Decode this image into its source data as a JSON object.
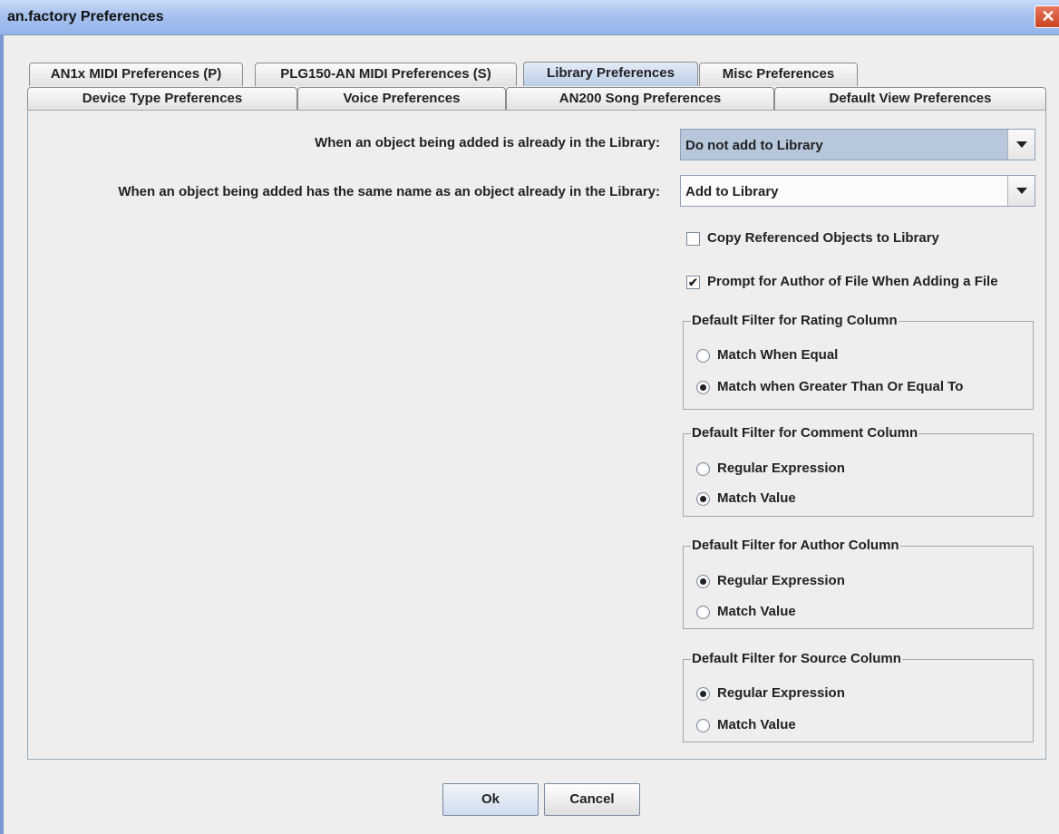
{
  "window": {
    "title": "an.factory Preferences",
    "close_icon": "✕"
  },
  "tabs": {
    "row1": [
      {
        "label": "AN1x MIDI Preferences (P)"
      },
      {
        "label": "PLG150-AN MIDI Preferences (S)"
      },
      {
        "label": "Library Preferences",
        "selected": true
      },
      {
        "label": "Misc Preferences"
      }
    ],
    "row2": [
      {
        "label": "Device Type Preferences"
      },
      {
        "label": "Voice Preferences"
      },
      {
        "label": "AN200 Song Preferences"
      },
      {
        "label": "Default View Preferences"
      }
    ]
  },
  "library": {
    "already_in_library": {
      "label": "When an object being added is already in the Library:",
      "value": "Do not add to Library"
    },
    "same_name": {
      "label": "When an object being added has the same name as an object already in the Library:",
      "value": "Add to Library"
    },
    "copy_referenced": {
      "label": "Copy Referenced Objects to Library",
      "checked": false
    },
    "prompt_author": {
      "label": "Prompt for Author of File When Adding a File",
      "checked": true,
      "check_glyph": "✔"
    },
    "rating_filter": {
      "title": "Default Filter for Rating Column",
      "options": [
        {
          "label": "Match When Equal",
          "selected": false
        },
        {
          "label": "Match when Greater Than Or Equal To",
          "selected": true
        }
      ]
    },
    "comment_filter": {
      "title": "Default Filter for Comment Column",
      "options": [
        {
          "label": "Regular Expression",
          "selected": false
        },
        {
          "label": "Match Value",
          "selected": true
        }
      ]
    },
    "author_filter": {
      "title": "Default Filter for Author Column",
      "options": [
        {
          "label": "Regular Expression",
          "selected": true
        },
        {
          "label": "Match Value",
          "selected": false
        }
      ]
    },
    "source_filter": {
      "title": "Default Filter for Source Column",
      "options": [
        {
          "label": "Regular Expression",
          "selected": true
        },
        {
          "label": "Match Value",
          "selected": false
        }
      ]
    }
  },
  "buttons": {
    "ok": "Ok",
    "cancel": "Cancel"
  },
  "colors": {
    "title_bar": "#a6c1ee",
    "selected_tab": "#b8cde6",
    "selected_combo": "#b8c8dc",
    "close_button": "#c94420"
  }
}
